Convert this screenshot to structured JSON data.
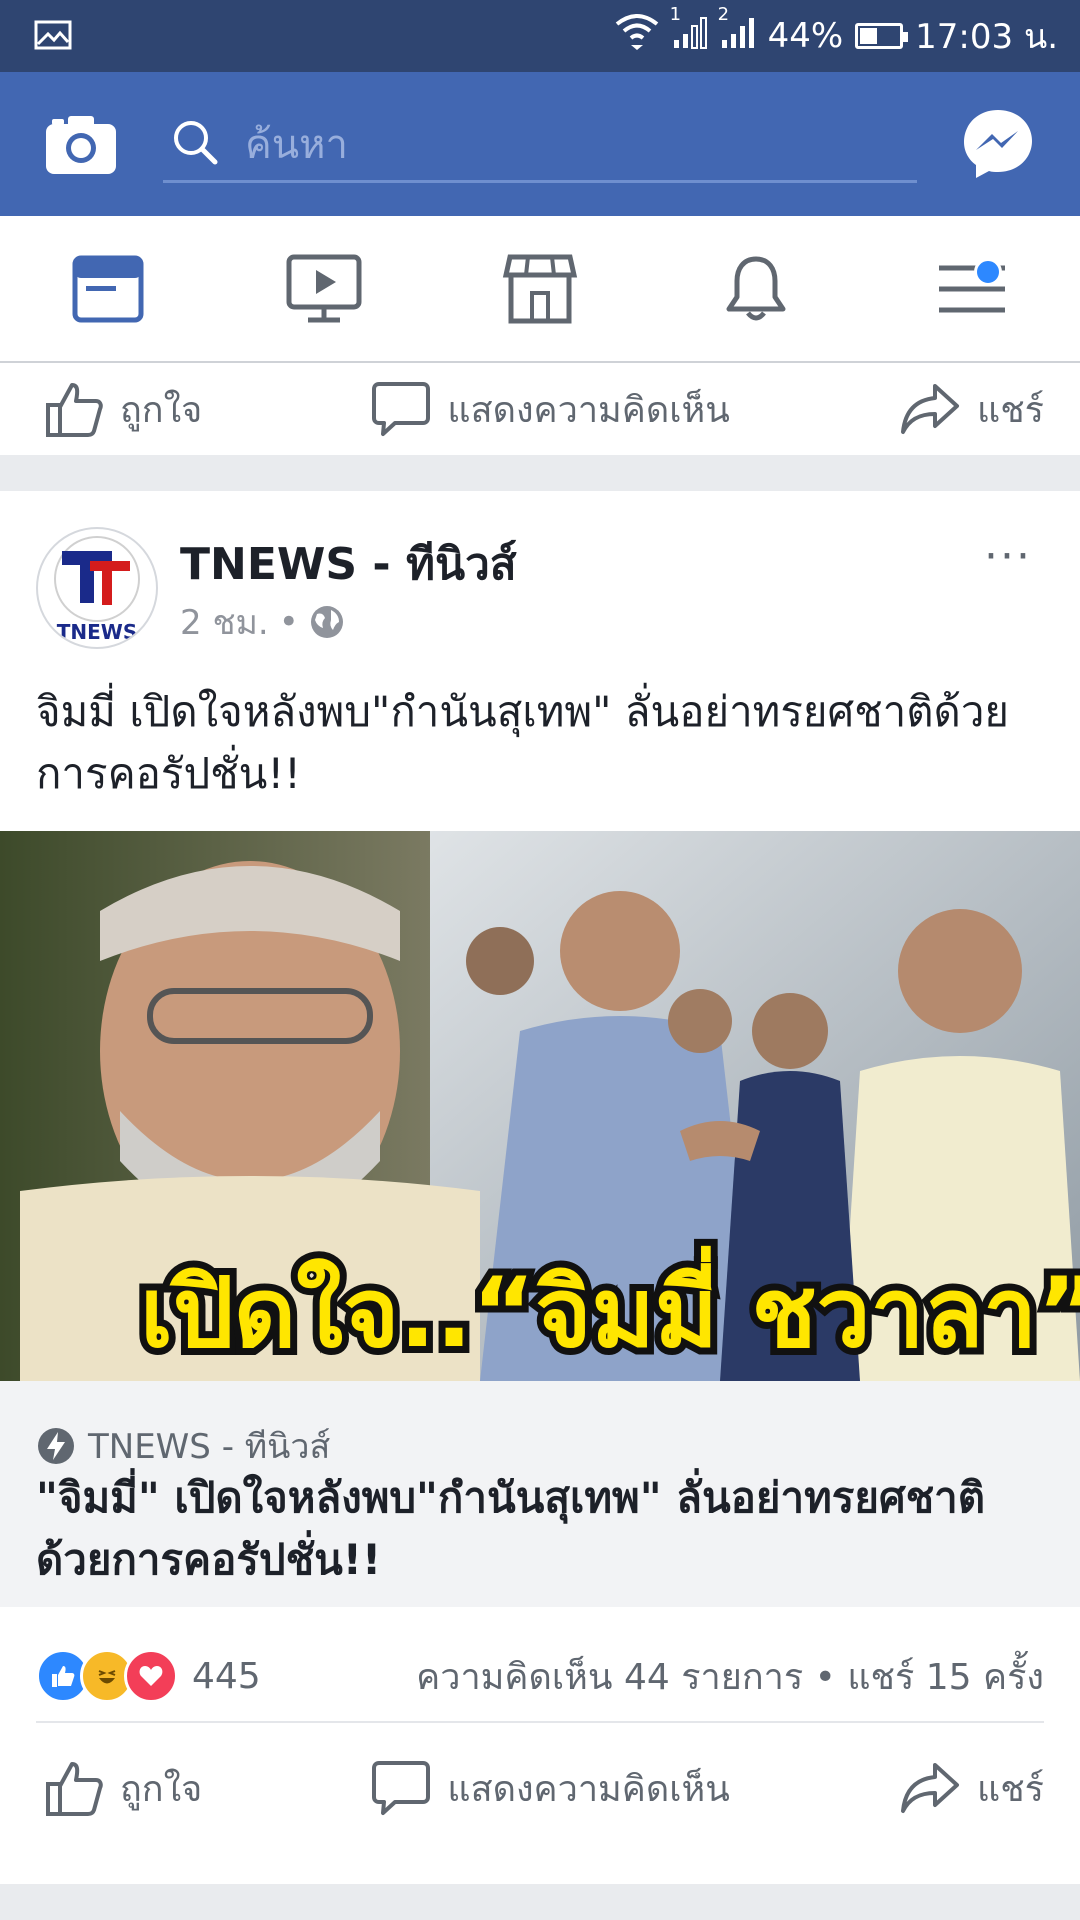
{
  "status_bar": {
    "sim1": "1",
    "sim2": "2",
    "battery": "44%",
    "battery_level": 0.44,
    "time": "17:03 น."
  },
  "header": {
    "search_placeholder": "ค้นหา"
  },
  "nav": {
    "tabs": [
      "news-feed",
      "watch",
      "marketplace",
      "notifications",
      "menu"
    ]
  },
  "actions": {
    "like": "ถูกใจ",
    "comment": "แสดงความคิดเห็น",
    "share": "แชร์"
  },
  "post": {
    "page_name": "TNEWS - ทีนิวส์",
    "time": "2 ชม.",
    "separator": "•",
    "more": "···",
    "caption": "จิมมี่ เปิดใจหลังพบ\"กำนันสุเทพ\" ลั่นอย่าทรยศชาติด้วยการคอรัปชั่น!!",
    "image_overlay_text": "เปิดใจ..“จิมมี่ ชวาลา”",
    "avatar_text": "TNEWS",
    "link": {
      "source": "TNEWS - ทีนิวส์",
      "title": "\"จิมมี่\" เปิดใจหลังพบ\"กำนันสุเทพ\" ลั่นอย่าทรยศชาติด้วยการคอรัปชั่น!!"
    },
    "reaction_count": "445",
    "comments_shares": "ความคิดเห็น 44 รายการ • แชร์ 15 ครั้ง"
  },
  "colors": {
    "status_bar": "#2f4571",
    "header": "#4267b2",
    "accent": "#4267b2",
    "notification_dot": "#2d88ff",
    "overlay_text": "#ffe600"
  }
}
